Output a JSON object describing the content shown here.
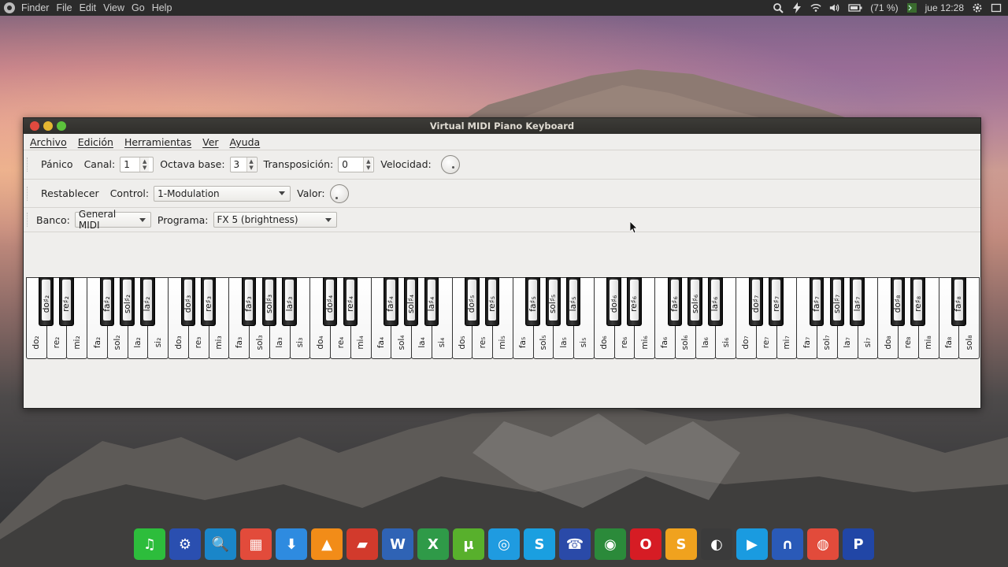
{
  "topbar": {
    "menu": [
      "Finder",
      "File",
      "Edit",
      "View",
      "Go",
      "Help"
    ],
    "battery": "(71 %)",
    "clock": "jue 12:28",
    "icons": [
      "search-icon",
      "bolt-icon",
      "wifi-icon",
      "volume-icon",
      "battery-icon",
      "terminal-icon",
      "gear-icon",
      "window-icon"
    ]
  },
  "window": {
    "title": "Virtual MIDI Piano Keyboard",
    "menu": [
      "Archivo",
      "Edición",
      "Herramientas",
      "Ver",
      "Ayuda"
    ],
    "toolbar1": {
      "panic": "Pánico",
      "channel_label": "Canal:",
      "channel_value": "1",
      "octave_label": "Octava base:",
      "octave_value": "3",
      "transpose_label": "Transposición:",
      "transpose_value": "0",
      "velocity_label": "Velocidad:"
    },
    "toolbar2": {
      "reset": "Restablecer",
      "control_label": "Control:",
      "control_value": "1-Modulation",
      "value_label": "Valor:"
    },
    "toolbar3": {
      "bank_label": "Banco:",
      "bank_value": "General MIDI",
      "program_label": "Programa:",
      "program_value": "FX 5 (brightness)"
    }
  },
  "keyboard": {
    "white_keys": [
      "do₂",
      "re₂",
      "mi₂",
      "fa₂",
      "sol₂",
      "la₂",
      "si₂",
      "do₃",
      "re₃",
      "mi₃",
      "fa₃",
      "sol₃",
      "la₃",
      "si₃",
      "do₄",
      "re₄",
      "mi₄",
      "fa₄",
      "sol₄",
      "la₄",
      "si₄",
      "do₅",
      "re₅",
      "mi₅",
      "fa₅",
      "sol₅",
      "la₅",
      "si₅",
      "do₆",
      "re₆",
      "mi₆",
      "fa₆",
      "sol₆",
      "la₆",
      "si₆",
      "do₇",
      "re₇",
      "mi₇",
      "fa₇",
      "sol₇",
      "la₇",
      "si₇",
      "do₈",
      "re₈",
      "mi₈",
      "fa₈",
      "sol₈"
    ],
    "black_keys": [
      "do♯₂",
      "re♯₂",
      "fa♯₂",
      "sol♯₂",
      "la♯₂",
      "do♯₃",
      "re♯₃",
      "fa♯₃",
      "sol♯₃",
      "la♯₃",
      "do♯₄",
      "re♯₄",
      "fa♯₄",
      "sol♯₄",
      "la♯₄",
      "do♯₅",
      "re♯₅",
      "fa♯₅",
      "sol♯₅",
      "la♯₅",
      "do♯₆",
      "re♯₆",
      "fa♯₆",
      "sol♯₆",
      "la♯₆",
      "do♯₇",
      "re♯₇",
      "fa♯₇",
      "sol♯₇",
      "la♯₇",
      "do♯₈",
      "re♯₈",
      "fa♯₈"
    ]
  },
  "dock": [
    {
      "name": "music-icon",
      "glyph": "♫",
      "color": "#2dbd3c"
    },
    {
      "name": "app-icon",
      "glyph": "⚙",
      "color": "#2a4fb0"
    },
    {
      "name": "search-app-icon",
      "glyph": "🔍",
      "color": "#1a86c9"
    },
    {
      "name": "calculator-icon",
      "glyph": "▦",
      "color": "#e24b3b"
    },
    {
      "name": "download-icon",
      "glyph": "⬇",
      "color": "#2e8be0"
    },
    {
      "name": "vlc-icon",
      "glyph": "▲",
      "color": "#f28c18"
    },
    {
      "name": "files-icon",
      "glyph": "▰",
      "color": "#d23a2c"
    },
    {
      "name": "word-icon",
      "glyph": "W",
      "color": "#2f63b5"
    },
    {
      "name": "excel-icon",
      "glyph": "X",
      "color": "#2f9a48"
    },
    {
      "name": "utorrent-icon",
      "glyph": "µ",
      "color": "#58b02c"
    },
    {
      "name": "safari-icon",
      "glyph": "◎",
      "color": "#1f9be0"
    },
    {
      "name": "skype-icon",
      "glyph": "S",
      "color": "#1a9fe0"
    },
    {
      "name": "phone-icon",
      "glyph": "☎",
      "color": "#2a4aa8"
    },
    {
      "name": "globe-icon",
      "glyph": "◉",
      "color": "#2b8a3a"
    },
    {
      "name": "opera-icon",
      "glyph": "O",
      "color": "#d61c24"
    },
    {
      "name": "sublime-icon",
      "glyph": "S",
      "color": "#f0a21e"
    },
    {
      "name": "steam-icon",
      "glyph": "◐",
      "color": "#3b3b3b"
    },
    {
      "name": "play-icon",
      "glyph": "▶",
      "color": "#1a9be0"
    },
    {
      "name": "headphones-icon",
      "glyph": "∩",
      "color": "#2a5ab8"
    },
    {
      "name": "chrome-icon",
      "glyph": "◍",
      "color": "#e24b3b"
    },
    {
      "name": "pandora-icon",
      "glyph": "P",
      "color": "#2146a6"
    }
  ]
}
